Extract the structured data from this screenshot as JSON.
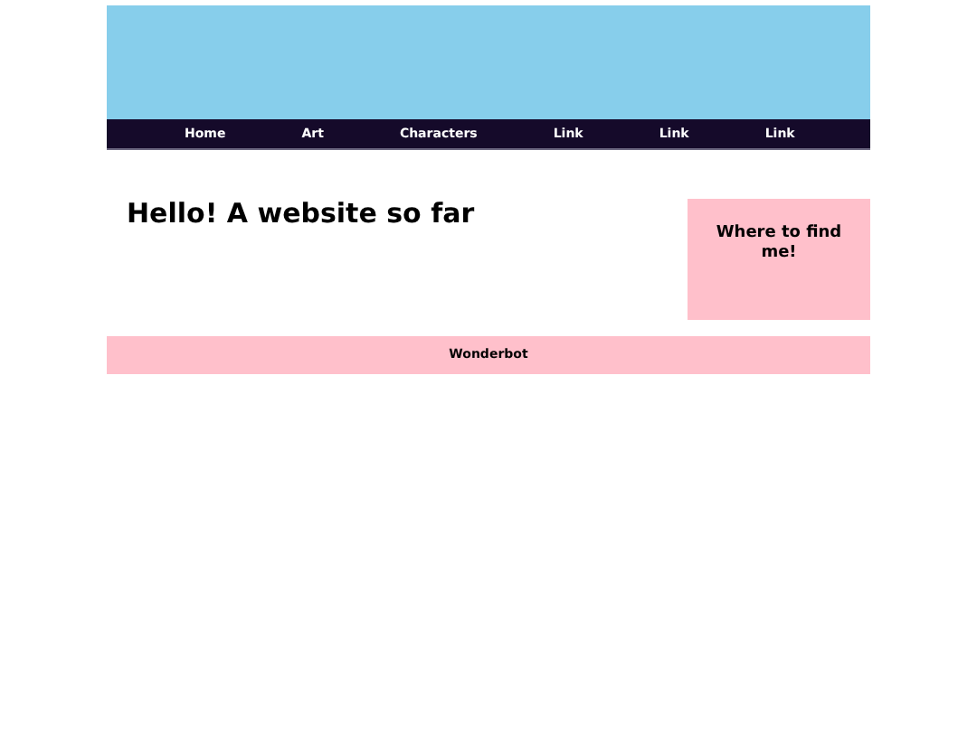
{
  "nav": [
    {
      "label": "Home"
    },
    {
      "label": "Art"
    },
    {
      "label": "Characters"
    },
    {
      "label": "Link"
    },
    {
      "label": "Link"
    },
    {
      "label": "Link"
    }
  ],
  "main": {
    "heading": "Hello! A website so far"
  },
  "aside": {
    "heading": "Where to find me!"
  },
  "footer": {
    "text": "Wonderbot"
  }
}
